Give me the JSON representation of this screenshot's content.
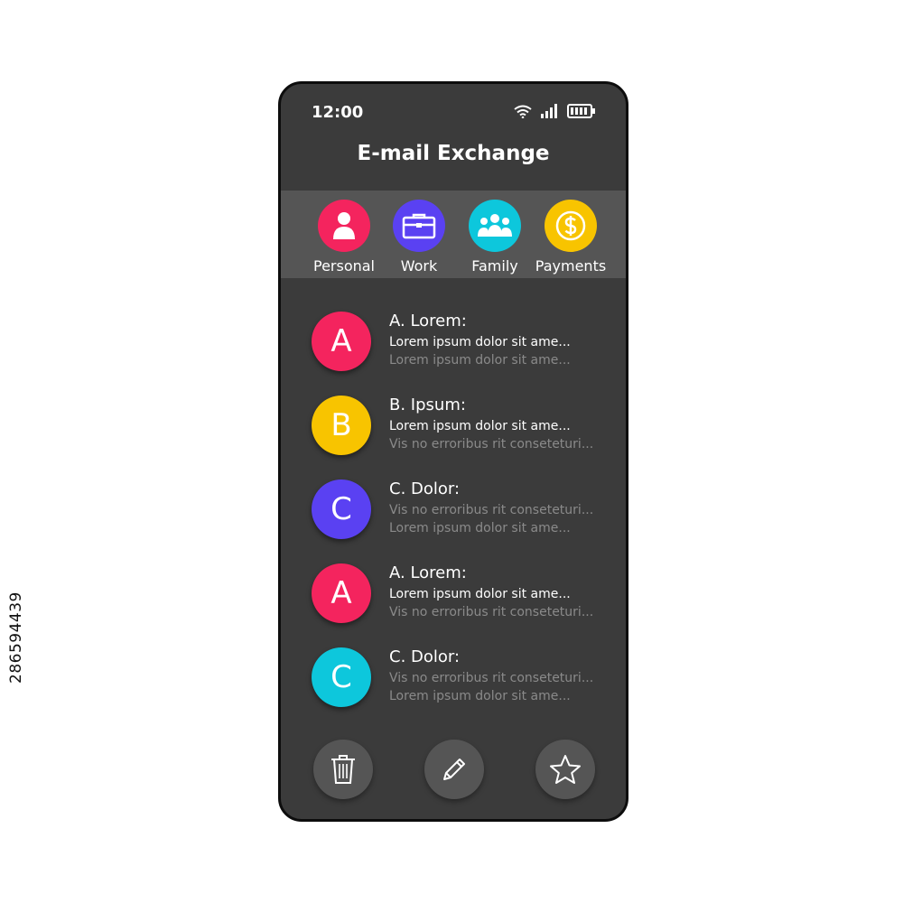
{
  "status_bar": {
    "time": "12:00"
  },
  "app": {
    "title": "E-mail Exchange"
  },
  "categories": [
    {
      "label": "Personal",
      "color": "#f4245e",
      "icon": "person-icon"
    },
    {
      "label": "Work",
      "color": "#5a41f2",
      "icon": "briefcase-icon"
    },
    {
      "label": "Family",
      "color": "#0dc7dc",
      "icon": "group-icon"
    },
    {
      "label": "Payments",
      "color": "#f8c400",
      "icon": "dollar-coin-icon"
    }
  ],
  "emails": [
    {
      "letter": "A",
      "color": "#f4245e",
      "sender": "A. Lorem:",
      "line1": "Lorem ipsum dolor sit ame...",
      "line2": "Lorem ipsum dolor sit ame..."
    },
    {
      "letter": "B",
      "color": "#f8c400",
      "sender": "B. Ipsum:",
      "line1": "Lorem ipsum dolor sit ame...",
      "line2": "Vis no erroribus rit conseteturi..."
    },
    {
      "letter": "C",
      "color": "#5a41f2",
      "sender": "C. Dolor:",
      "line1": "Vis no erroribus rit conseteturi...",
      "line2": "Lorem ipsum dolor sit ame..."
    },
    {
      "letter": "A",
      "color": "#f4245e",
      "sender": "A. Lorem:",
      "line1": "Lorem ipsum dolor sit ame...",
      "line2": "Vis no erroribus rit conseteturi..."
    },
    {
      "letter": "C",
      "color": "#0dc7dc",
      "sender": "C. Dolor:",
      "line1": "Vis no erroribus rit conseteturi...",
      "line2": "Lorem ipsum dolor sit ame..."
    }
  ],
  "actions": [
    {
      "icon": "trash-icon"
    },
    {
      "icon": "pencil-icon"
    },
    {
      "icon": "star-icon"
    }
  ],
  "watermark": {
    "stock_id": "286594439"
  },
  "colors": {
    "screen_bg": "#3b3b3b",
    "category_bar_bg": "#555555",
    "primary_text": "#ffffff",
    "muted_text": "#8a8a8a"
  }
}
